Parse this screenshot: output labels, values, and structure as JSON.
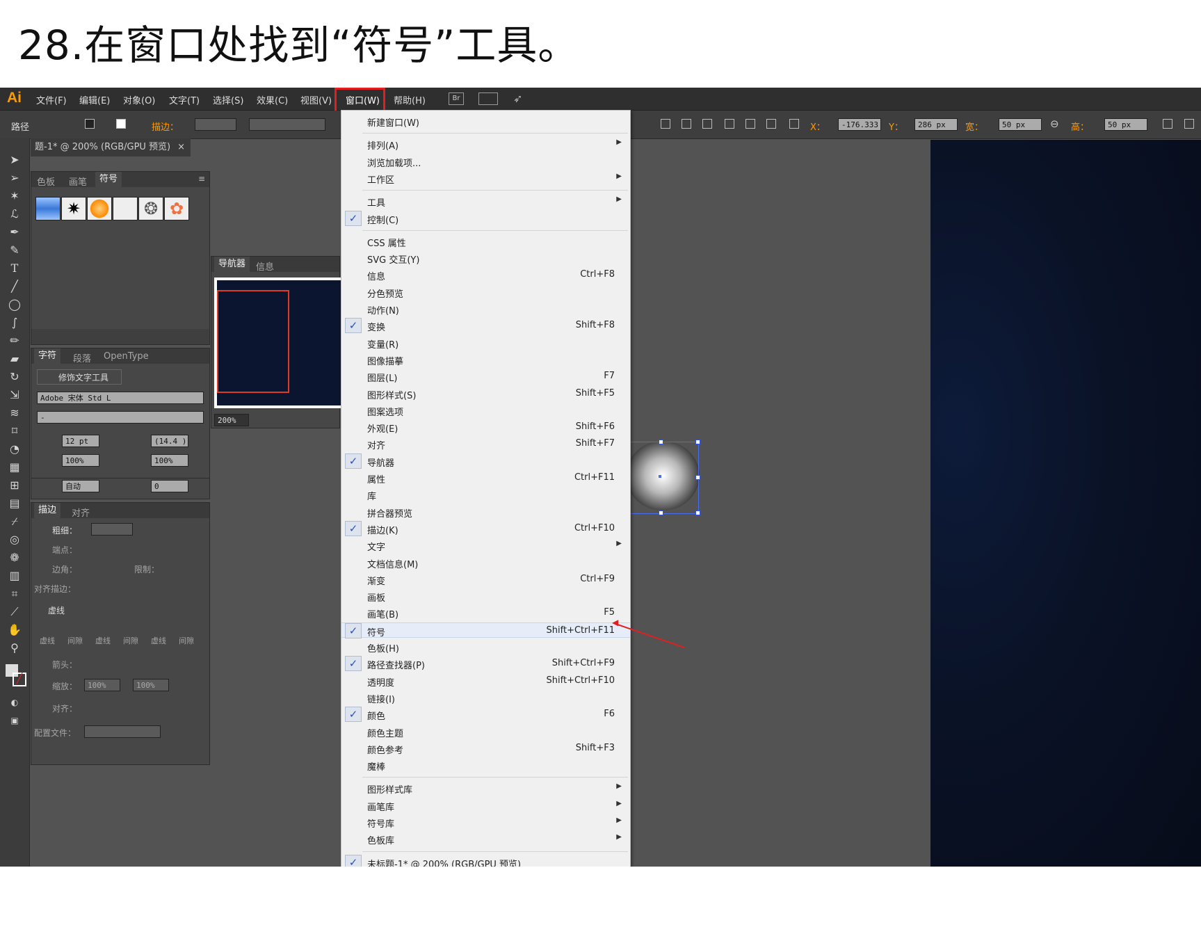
{
  "heading": "28.在窗口处找到“符号”工具。",
  "app": {
    "logo": "Ai",
    "menubar": [
      "文件(F)",
      "编辑(E)",
      "对象(O)",
      "文字(T)",
      "选择(S)",
      "效果(C)",
      "视图(V)",
      "窗口(W)",
      "帮助(H)"
    ],
    "menubar_extra": {
      "br": "Br"
    },
    "control_bar": {
      "path_label": "路径",
      "stroke_label": "描边：",
      "x_label": "X：",
      "x_value": "-176.333",
      "y_label": "Y：",
      "y_value": "286 px",
      "w_label": "宽：",
      "w_value": "50 px",
      "h_label": "高：",
      "h_value": "50 px"
    },
    "doc_tab": "题-1* @ 200% (RGB/GPU 预览)",
    "doc_tab_close": "×",
    "symbols_panel": {
      "tabs": [
        "色板",
        "画笔",
        "符号"
      ],
      "active": "符号"
    },
    "navigator_panel": {
      "tabs": [
        "导航器",
        "信息"
      ],
      "zoom": "200%"
    },
    "character_panel": {
      "tabs": [
        "字符",
        "段落",
        "OpenType"
      ],
      "touch_type": "修饰文字工具",
      "font_family": "Adobe 宋体 Std L",
      "font_style": "-",
      "size": "12 pt",
      "leading": "(14.4 )",
      "vscale": "100%",
      "hscale": "100%",
      "kerning": "自动",
      "tracking": "0"
    },
    "stroke_panel": {
      "tabs": [
        "描边",
        "对齐"
      ],
      "weight_label": "粗细：",
      "cap_label": "端点：",
      "corner_label": "边角：",
      "limit_label": "限制：",
      "align_label": "对齐描边：",
      "dashed_label": "虚线",
      "dash_fields": [
        "虚线",
        "间隙",
        "虚线",
        "间隙",
        "虚线",
        "间隙"
      ],
      "arrow_label": "箭头：",
      "scale_label": "缩放：",
      "scale_values": [
        "100%",
        "100%"
      ],
      "align2_label": "对齐：",
      "profile_label": "配置文件："
    }
  },
  "window_menu": {
    "groups": [
      [
        {
          "label": "新建窗口(W)"
        }
      ],
      [
        {
          "label": "排列(A)",
          "submenu": true
        },
        {
          "label": "浏览加载项..."
        },
        {
          "label": "工作区",
          "submenu": true
        }
      ],
      [
        {
          "label": "工具",
          "submenu": true
        },
        {
          "label": "控制(C)",
          "checked": true
        }
      ],
      [
        {
          "label": "CSS 属性"
        },
        {
          "label": "SVG 交互(Y)"
        },
        {
          "label": "信息",
          "shortcut": "Ctrl+F8"
        },
        {
          "label": "分色预览"
        },
        {
          "label": "动作(N)"
        },
        {
          "label": "变换",
          "shortcut": "Shift+F8",
          "checked": true
        },
        {
          "label": "变量(R)"
        },
        {
          "label": "图像描摹"
        },
        {
          "label": "图层(L)",
          "shortcut": "F7"
        },
        {
          "label": "图形样式(S)",
          "shortcut": "Shift+F5"
        },
        {
          "label": "图案选项"
        },
        {
          "label": "外观(E)",
          "shortcut": "Shift+F6"
        },
        {
          "label": "对齐",
          "shortcut": "Shift+F7"
        },
        {
          "label": "导航器",
          "checked": true
        },
        {
          "label": "属性",
          "shortcut": "Ctrl+F11"
        },
        {
          "label": "库"
        },
        {
          "label": "拼合器预览"
        },
        {
          "label": "描边(K)",
          "shortcut": "Ctrl+F10",
          "checked": true
        },
        {
          "label": "文字",
          "submenu": true
        },
        {
          "label": "文档信息(M)"
        },
        {
          "label": "渐变",
          "shortcut": "Ctrl+F9"
        },
        {
          "label": "画板"
        },
        {
          "label": "画笔(B)",
          "shortcut": "F5"
        },
        {
          "label": "符号",
          "shortcut": "Shift+Ctrl+F11",
          "checked": true,
          "highlighted": true
        },
        {
          "label": "色板(H)"
        },
        {
          "label": "路径查找器(P)",
          "shortcut": "Shift+Ctrl+F9",
          "checked": true
        },
        {
          "label": "透明度",
          "shortcut": "Shift+Ctrl+F10"
        },
        {
          "label": "链接(I)"
        },
        {
          "label": "颜色",
          "shortcut": "F6",
          "checked": true
        },
        {
          "label": "颜色主题"
        },
        {
          "label": "颜色参考",
          "shortcut": "Shift+F3"
        },
        {
          "label": "魔棒"
        }
      ],
      [
        {
          "label": "图形样式库",
          "submenu": true
        },
        {
          "label": "画笔库",
          "submenu": true
        },
        {
          "label": "符号库",
          "submenu": true
        },
        {
          "label": "色板库",
          "submenu": true
        }
      ],
      [
        {
          "label": "未标题-1* @ 200% (RGB/GPU 预览)",
          "checked": true
        }
      ]
    ]
  },
  "colors": {
    "accent_red": "#e02020",
    "check_blue": "#2c4fb5",
    "ai_orange": "#ff9a00"
  }
}
